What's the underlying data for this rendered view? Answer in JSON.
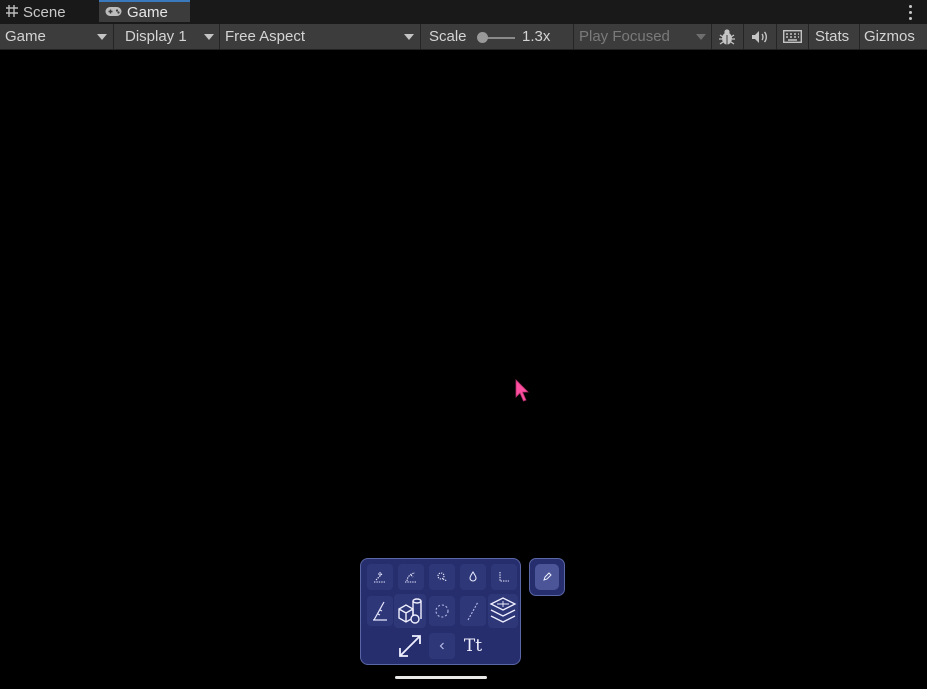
{
  "tabs": [
    {
      "label": "Scene",
      "icon": "grid-icon",
      "active": false
    },
    {
      "label": "Game",
      "icon": "gamepad-icon",
      "active": true
    }
  ],
  "toolbar": {
    "view_mode": "Game",
    "display": "Display 1",
    "aspect": "Free Aspect",
    "scale_label": "Scale",
    "scale_value": "1.3x",
    "play_mode": "Play Focused",
    "stats_label": "Stats",
    "gizmos_label": "Gizmos",
    "icons": [
      "bug-icon",
      "speaker-icon",
      "keyboard-icon"
    ]
  },
  "toolbox": {
    "tools_row1": [
      "tool-1-icon",
      "tool-2-icon",
      "tool-3-icon",
      "drop-icon",
      "corner-icon"
    ],
    "tools_row2": [
      "ruler-icon",
      "shapes-icon",
      "circle-icon",
      "line-icon",
      "layers-icon"
    ],
    "tools_row3": [
      "expand-icon",
      "chevron-left-icon",
      "text-icon"
    ],
    "text_label": "Tt",
    "side_icon": "pencil-icon"
  },
  "colors": {
    "toolbar_bg": "#3c3c3c",
    "tab_bg": "#191919",
    "toolbox_bg": "#262e6e",
    "cursor": "#ff4fa0",
    "active_tab_accent": "#3a79bb"
  }
}
